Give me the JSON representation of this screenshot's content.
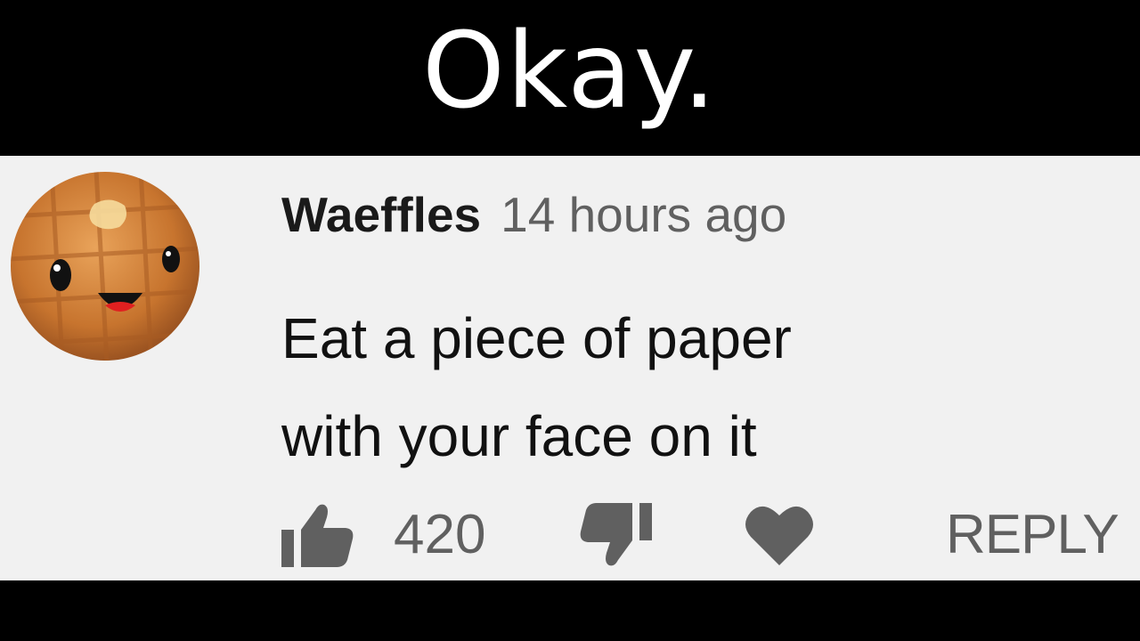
{
  "caption": {
    "text": "Okay."
  },
  "comment": {
    "author": "Waeffles",
    "timestamp": "14 hours ago",
    "text_lines": [
      "Eat a piece of paper",
      "with your face on it"
    ],
    "avatar_icon": "waffle-face-avatar"
  },
  "actions": {
    "like_icon": "thumbs-up-icon",
    "like_count": "420",
    "dislike_icon": "thumbs-down-icon",
    "heart_icon": "heart-icon",
    "reply_label": "REPLY"
  },
  "colors": {
    "background_band": "#000000",
    "card_background": "#f1f1f1",
    "caption_text": "#ffffff",
    "secondary_text": "#606060",
    "primary_text": "#111111"
  }
}
